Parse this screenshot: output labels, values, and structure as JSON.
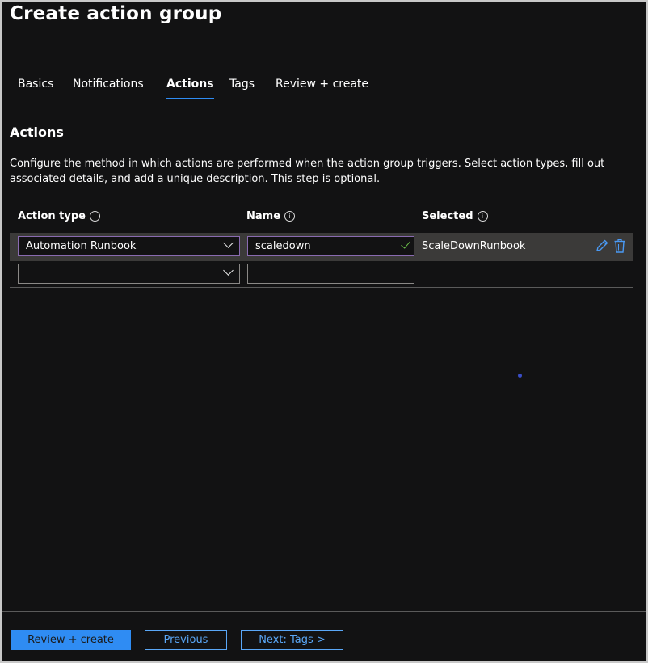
{
  "page": {
    "title": "Create action group"
  },
  "tabs": [
    {
      "label": "Basics"
    },
    {
      "label": "Notifications"
    },
    {
      "label": "Actions"
    },
    {
      "label": "Tags"
    },
    {
      "label": "Review + create"
    }
  ],
  "active_tab": "Actions",
  "section": {
    "title": "Actions",
    "description": "Configure the method in which actions are performed when the action group triggers. Select action types, fill out associated details, and add a unique description. This step is optional."
  },
  "columns": {
    "action_type": "Action type",
    "name": "Name",
    "selected": "Selected",
    "info_glyph": "i"
  },
  "rows": [
    {
      "action_type": "Automation Runbook",
      "name": "scaledown",
      "selected": "ScaleDownRunbook"
    },
    {
      "action_type": "",
      "name": "",
      "selected": ""
    }
  ],
  "footer": {
    "review_create": "Review + create",
    "previous": "Previous",
    "next": "Next: Tags >"
  },
  "colors": {
    "accent": "#2f8cf3",
    "row_highlight": "#3b3a39",
    "valid_check": "#6cc04a",
    "focus_border": "#8a6bb1"
  },
  "icons": [
    "chevron-down-icon",
    "checkmark-icon",
    "edit-icon",
    "delete-icon",
    "info-icon"
  ]
}
